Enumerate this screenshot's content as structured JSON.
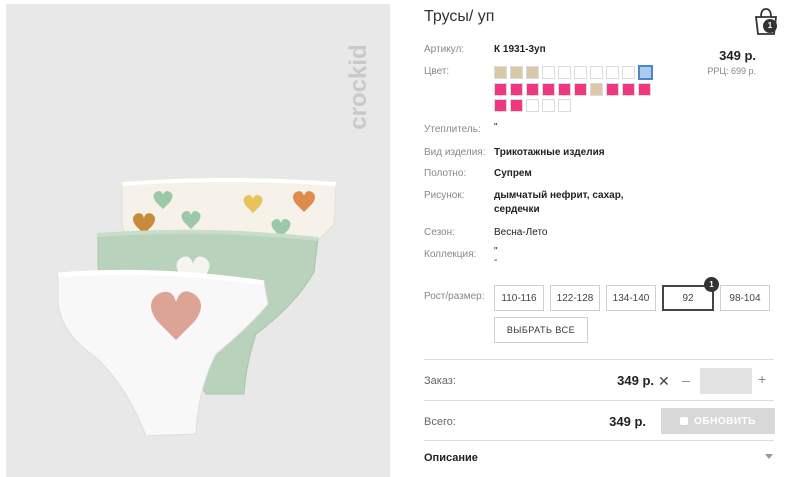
{
  "product": {
    "title": "Трусы/ уп",
    "brand": "crockid",
    "price": "349 р.",
    "rrp": "РРЦ: 699 р."
  },
  "cart": {
    "icon": "shopping-bag-icon",
    "count": "1"
  },
  "attributes": {
    "article_label": "Артикул:",
    "article_value": "К 1931-3уп",
    "color_label": "Цвет:",
    "insulation_label": "Утеплитель:",
    "insulation_value": "\"",
    "type_label": "Вид изделия:",
    "type_value": "Трикотажные изделия",
    "fabric_label": "Полотно:",
    "fabric_value": "Супрем",
    "pattern_label": "Рисунок:",
    "pattern_line1": "дымчатый нефрит, сахар,",
    "pattern_line2": "сердечки",
    "season_label": "Сезон:",
    "season_value": "Весна-Лето",
    "collection_label": "Коллекция:",
    "collection_line1": "\"",
    "collection_line2": "-"
  },
  "swatches": [
    {
      "color": "#d9c9a8"
    },
    {
      "color": "#d9c9a8"
    },
    {
      "color": "#d9c9a8"
    },
    {
      "color": "#ffffff"
    },
    {
      "color": "#ffffff"
    },
    {
      "color": "#ffffff"
    },
    {
      "color": "#ffffff"
    },
    {
      "color": "#ffffff"
    },
    {
      "color": "#ffffff"
    },
    {
      "color": "#a9cdf2",
      "selected": true
    },
    {
      "color": "#f0377f"
    },
    {
      "color": "#f0377f"
    },
    {
      "color": "#f0377f"
    },
    {
      "color": "#f0377f"
    },
    {
      "color": "#f0377f"
    },
    {
      "color": "#f0377f"
    },
    {
      "color": "#d9c9a8"
    },
    {
      "color": "#f0377f"
    },
    {
      "color": "#f0377f"
    },
    {
      "color": "#f0377f"
    },
    {
      "color": "#f0377f"
    },
    {
      "color": "#f0377f"
    },
    {
      "color": "#ffffff"
    },
    {
      "color": "#ffffff"
    },
    {
      "color": "#ffffff"
    }
  ],
  "sizes": {
    "label": "Рост/размер:",
    "options": [
      "110-116",
      "122-128",
      "134-140",
      "92",
      "98-104"
    ],
    "active_index": 3,
    "badge": "1",
    "select_all": "ВЫБРАТЬ ВСЕ"
  },
  "order": {
    "label": "Заказ:",
    "price": "349 р.",
    "remove_icon": "close-icon",
    "minus": "–",
    "plus": "+",
    "quantity": ""
  },
  "total": {
    "label": "Всего:",
    "price": "349 р.",
    "update_button": "ОБНОВИТЬ"
  },
  "description": {
    "label": "Описание"
  },
  "colors": {
    "pink": "#f0377f",
    "beige": "#d9c9a8",
    "mint": "#b9d2bc",
    "heart_coral": "#dca495",
    "selected_border": "#4a86c8"
  }
}
